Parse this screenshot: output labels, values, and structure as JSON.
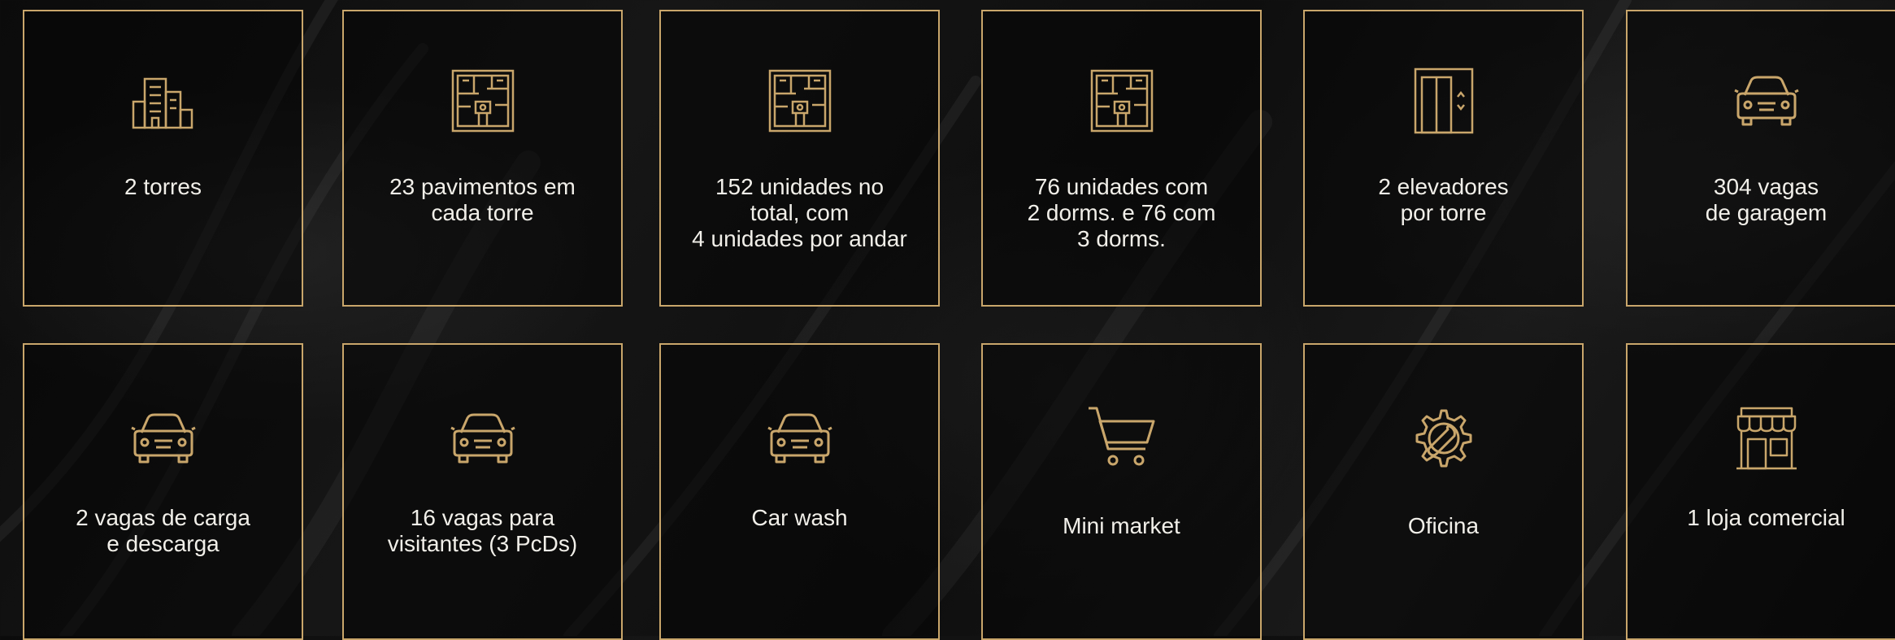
{
  "accent_color": "#c9a66b",
  "cards": [
    {
      "icon": "buildings-icon",
      "label": "2 torres"
    },
    {
      "icon": "floor-plan-icon",
      "label": "23 pavimentos em\ncada torre"
    },
    {
      "icon": "floor-plan-icon",
      "label": "152 unidades no\ntotal, com\n4 unidades por andar"
    },
    {
      "icon": "floor-plan-icon",
      "label": "76 unidades com\n2 dorms. e 76 com\n3 dorms."
    },
    {
      "icon": "elevator-icon",
      "label": "2 elevadores\npor torre"
    },
    {
      "icon": "car-icon",
      "label": "304 vagas\nde garagem"
    },
    {
      "icon": "car-icon",
      "label": "2 vagas de carga\ne descarga"
    },
    {
      "icon": "car-icon",
      "label": "16 vagas para\nvisitantes (3 PcDs)"
    },
    {
      "icon": "car-icon",
      "label": "Car wash"
    },
    {
      "icon": "shopping-cart-icon",
      "label": "Mini market"
    },
    {
      "icon": "gear-wrench-icon",
      "label": "Oficina"
    },
    {
      "icon": "storefront-icon",
      "label": "1 loja comercial"
    }
  ]
}
